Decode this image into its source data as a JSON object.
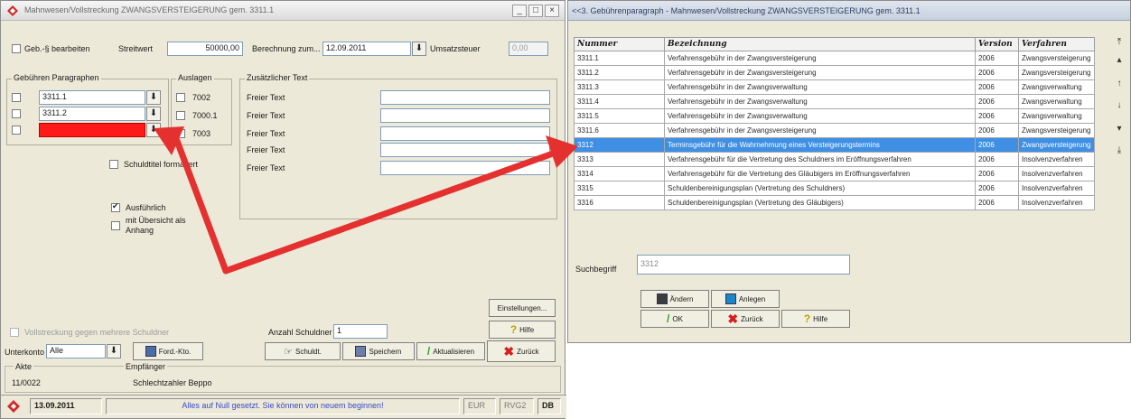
{
  "left_window": {
    "title": "Mahnwesen/Vollstreckung ZWANGSVERSTEIGERUNG gem. 3311.1",
    "controls": {
      "minimize": "_",
      "maximize": "□",
      "close": "×"
    },
    "geb_bearbeiten_label": "Geb.-§ bearbeiten",
    "streitwert_label": "Streitwert",
    "streitwert_value": "50000,00",
    "berechnung_label": "Berechnung zum...",
    "berechnung_value": "12.09.2011",
    "umsatzsteuer_label": "Umsatzsteuer",
    "umsatzsteuer_value": "0,00",
    "gebuehren_title": "Gebühren Paragraphen",
    "gebuehren_rows": [
      "3311.1",
      "3311.2",
      ""
    ],
    "auslagen_title": "Auslagen",
    "auslagen_items": [
      "7002",
      "7000.1",
      "7003"
    ],
    "zusatz_title": "Zusätzlicher Text",
    "freier_text_labels": [
      "Freier Text",
      "Freier Text",
      "Freier Text",
      "Freier Text",
      "Freier Text"
    ],
    "schuldtitel_label": "Schuldtitel formatiert",
    "ausfuehrlich_label": "Ausführlich",
    "uebersicht_label": "mit Übersicht als Anhang",
    "vollstreckung_label": "Vollstreckung gegen mehrere Schuldner",
    "anzahl_schuldner_label": "Anzahl Schuldner",
    "anzahl_schuldner_value": "1",
    "einstellungen_label": "Einstellungen...",
    "hilfe_label": "Hilfe",
    "unterkonto_label": "Unterkonto",
    "unterkonto_value": "Alle",
    "ford_kto_label": "Ford.-Kto.",
    "schuldt_label": "Schuldt.",
    "speichern_label": "Speichern",
    "aktualisieren_label": "Aktualisieren",
    "zurueck_label": "Zurück",
    "akte_label": "Akte",
    "akte_value": "11/0022",
    "empfaenger_label": "Empfänger",
    "empfaenger_value": "Schlechtzahler Beppo",
    "status": {
      "date": "13.09.2011",
      "message": "Alles auf Null gesetzt. Sie können von neuem beginnen!",
      "currency": "EUR",
      "rvg": "RVG2",
      "db": "DB"
    }
  },
  "right_window": {
    "title": "<<3. Gebührenparagraph - Mahnwesen/Vollstreckung ZWANGSVERSTEIGERUNG gem. 3311.1",
    "columns": [
      "Nummer",
      "Bezeichnung",
      "Version",
      "Verfahren"
    ],
    "rows": [
      [
        "3311.1",
        "Verfahrensgebühr in der Zwangsversteigerung",
        "2006",
        "Zwangsversteigerung"
      ],
      [
        "3311.2",
        "Verfahrensgebühr in der Zwangsversteigerung",
        "2006",
        "Zwangsversteigerung"
      ],
      [
        "3311.3",
        "Verfahrensgebühr in der Zwangsverwaltung",
        "2006",
        "Zwangsverwaltung"
      ],
      [
        "3311.4",
        "Verfahrensgebühr in der Zwangsverwaltung",
        "2006",
        "Zwangsverwaltung"
      ],
      [
        "3311.5",
        "Verfahrensgebühr in der Zwangsverwaltung",
        "2006",
        "Zwangsverwaltung"
      ],
      [
        "3311.6",
        "Verfahrensgebühr in der Zwangsversteigerung",
        "2006",
        "Zwangsversteigerung"
      ],
      [
        "3312",
        "Terminsgebühr für die Wahrnehmung eines Versteigerungstermins",
        "2006",
        "Zwangsversteigerung"
      ],
      [
        "3313",
        "Verfahrensgebühr für die Vertretung des Schuldners im Eröffnungsverfahren",
        "2006",
        "Insolvenzverfahren"
      ],
      [
        "3314",
        "Verfahrensgebühr für die Vertretung des Gläubigers im Eröffnungsverfahren",
        "2006",
        "Insolvenzverfahren"
      ],
      [
        "3315",
        "Schuldenbereinigungsplan (Vertretung des Schuldners)",
        "2006",
        "Insolvenzverfahren"
      ],
      [
        "3316",
        "Schuldenbereinigungsplan (Vertretung des Gläubigers)",
        "2006",
        "Insolvenzverfahren"
      ]
    ],
    "selected_row_index": 6,
    "suchbegriff_label": "Suchbegriff",
    "suchbegriff_value": "3312",
    "aendern_label": "Ändern",
    "anlegen_label": "Anlegen",
    "ok_label": "OK",
    "zurueck_label": "Zurück",
    "hilfe_label": "Hilfe"
  },
  "annotation": {
    "color": "#e53030"
  },
  "colors": {
    "selection": "#3f8fe4",
    "highlight_field": "#ff1a1a",
    "window_bg": "#ece9d8"
  }
}
